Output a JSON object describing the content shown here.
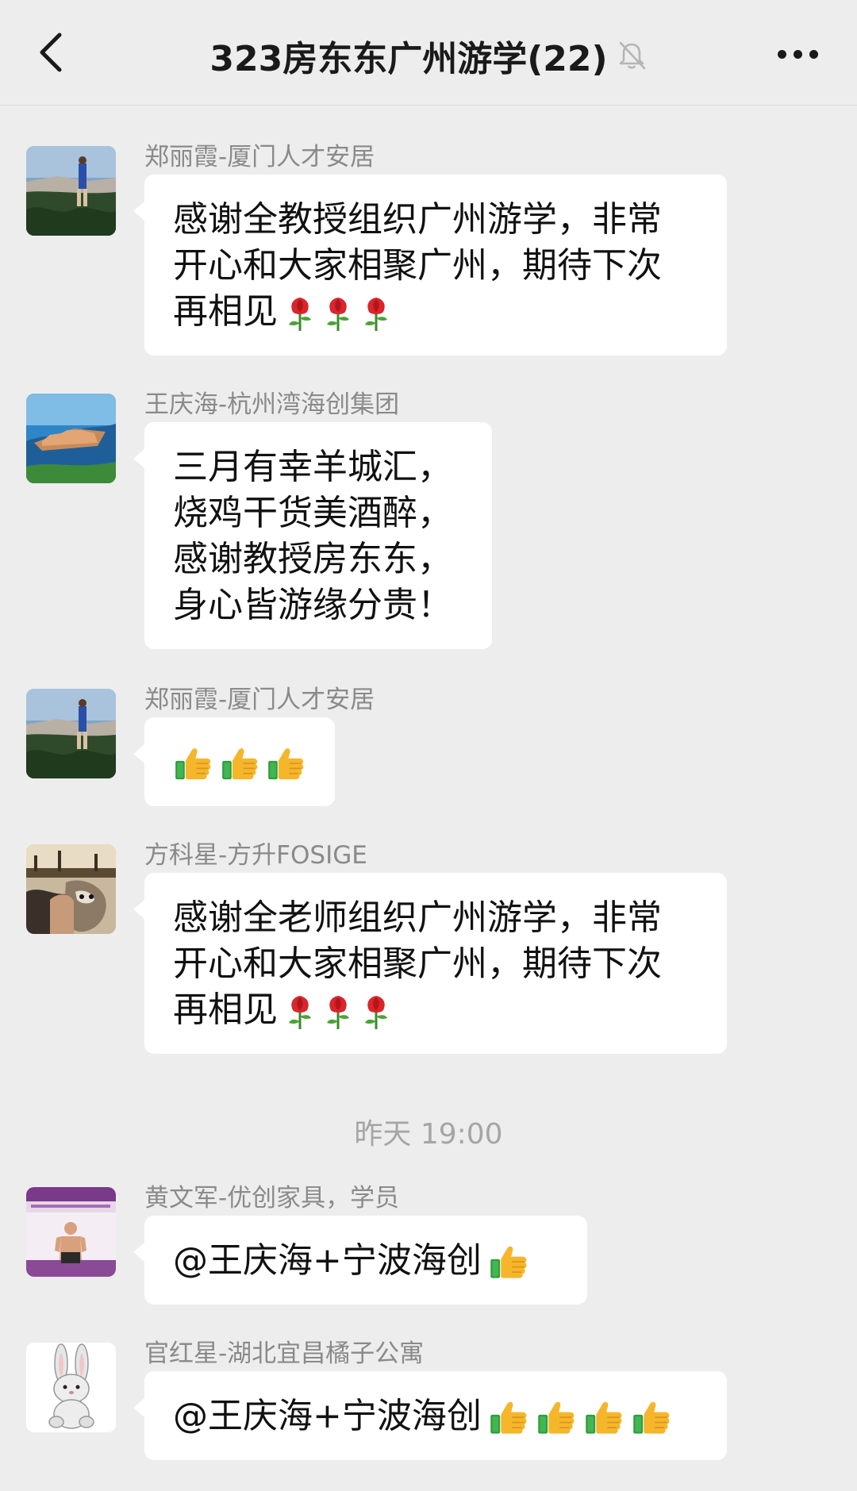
{
  "header": {
    "title": "323房东东广州游学(22)",
    "back_icon": "chevron-left-icon",
    "mute_icon": "bell-off-icon",
    "more_icon": "more-dots-icon"
  },
  "messages": [
    {
      "sender": "郑丽霞-厦门人才安居",
      "text": "感谢全教授组织广州游学，非常\n开心和大家相聚广州，期待下次\n再相见",
      "trailing_emoji": [
        "rose",
        "rose",
        "rose"
      ]
    },
    {
      "sender": "王庆海-杭州湾海创集团",
      "text": "三月有幸羊城汇，\n烧鸡干货美酒醉，\n感谢教授房东东，\n身心皆游缘分贵！"
    },
    {
      "sender": "郑丽霞-厦门人才安居",
      "emoji": [
        "thumbs-up",
        "thumbs-up",
        "thumbs-up"
      ]
    },
    {
      "sender": "方科星-方升FOSIGE",
      "text": "感谢全老师组织广州游学，非常\n开心和大家相聚广州，期待下次\n再相见",
      "trailing_emoji": [
        "rose",
        "rose",
        "rose"
      ]
    },
    {
      "sender": "黄文军-优创家具，学员",
      "text": "@王庆海+宁波海创",
      "trailing_emoji": [
        "thumbs-up"
      ]
    },
    {
      "sender": "官红星-湖北宜昌橘子公寓",
      "text": "@王庆海+宁波海创",
      "trailing_emoji": [
        "thumbs-up",
        "thumbs-up",
        "thumbs-up",
        "thumbs-up"
      ]
    }
  ],
  "timestamp": "昨天 19:00",
  "colors": {
    "background": "#ededed",
    "bubble": "#ffffff",
    "sender_text": "#8a8a8a",
    "timestamp_text": "#a5a5a5"
  }
}
